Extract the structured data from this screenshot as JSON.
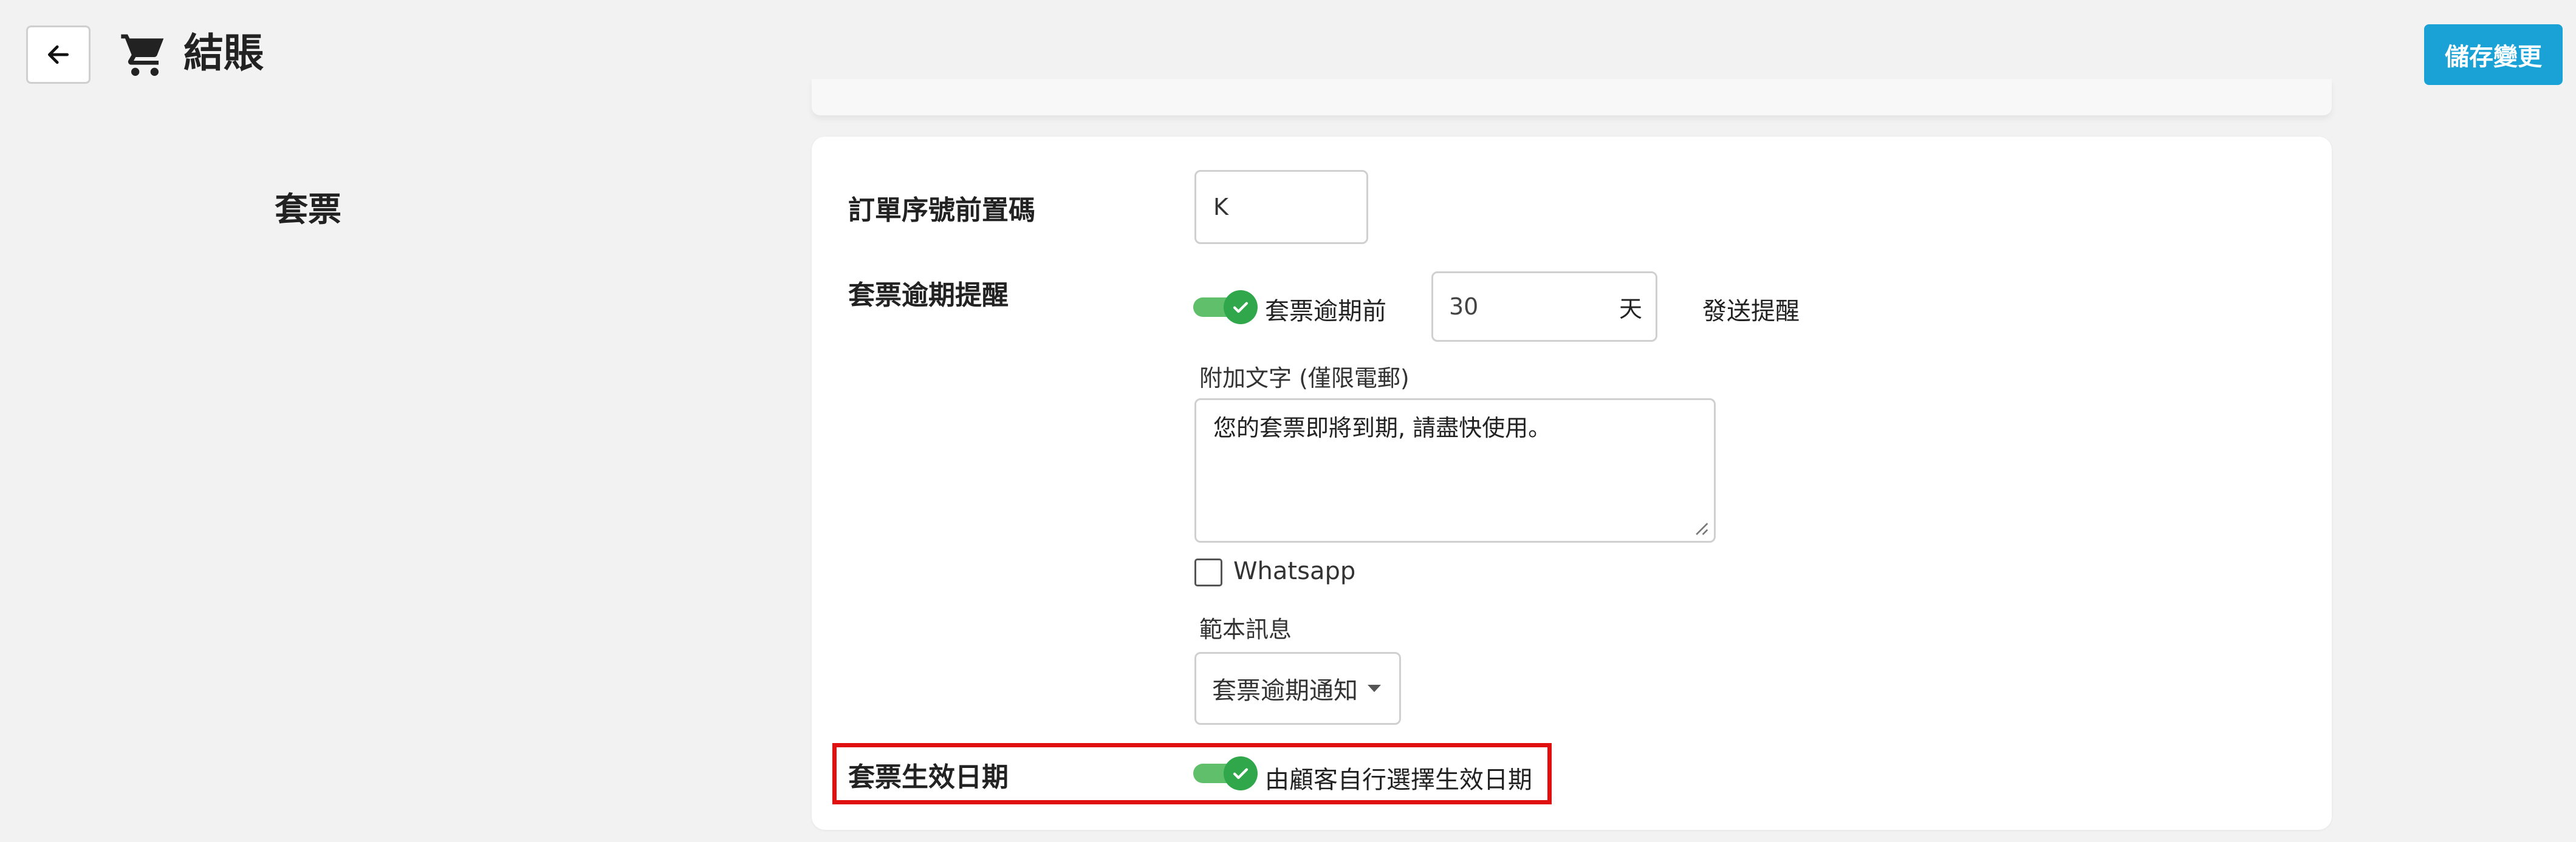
{
  "header": {
    "title": "結賬",
    "save_label": "儲存變更",
    "back_icon": "arrow-left-icon",
    "cart_icon": "shopping-cart-icon"
  },
  "section": {
    "title": "套票"
  },
  "rows": {
    "prefix": {
      "label": "訂單序號前置碼",
      "value": "K"
    },
    "expiry_reminder": {
      "label": "套票逾期提醒",
      "toggle_on": true,
      "toggle_label": "套票逾期前",
      "days_value": "30",
      "days_unit": "天",
      "suffix": "發送提醒",
      "extra_text_label": "附加文字 (僅限電郵)",
      "extra_text_value": "您的套票即將到期, 請盡快使用。",
      "whatsapp_label": "Whatsapp",
      "whatsapp_checked": false,
      "template_label": "範本訊息",
      "template_value": "套票逾期通知"
    },
    "effective_date": {
      "label": "套票生效日期",
      "toggle_on": true,
      "toggle_label": "由顧客自行選擇生效日期"
    }
  },
  "colors": {
    "primary": "#1aa2d6",
    "toggle_on": "#2fa74a",
    "highlight": "#e01010"
  }
}
